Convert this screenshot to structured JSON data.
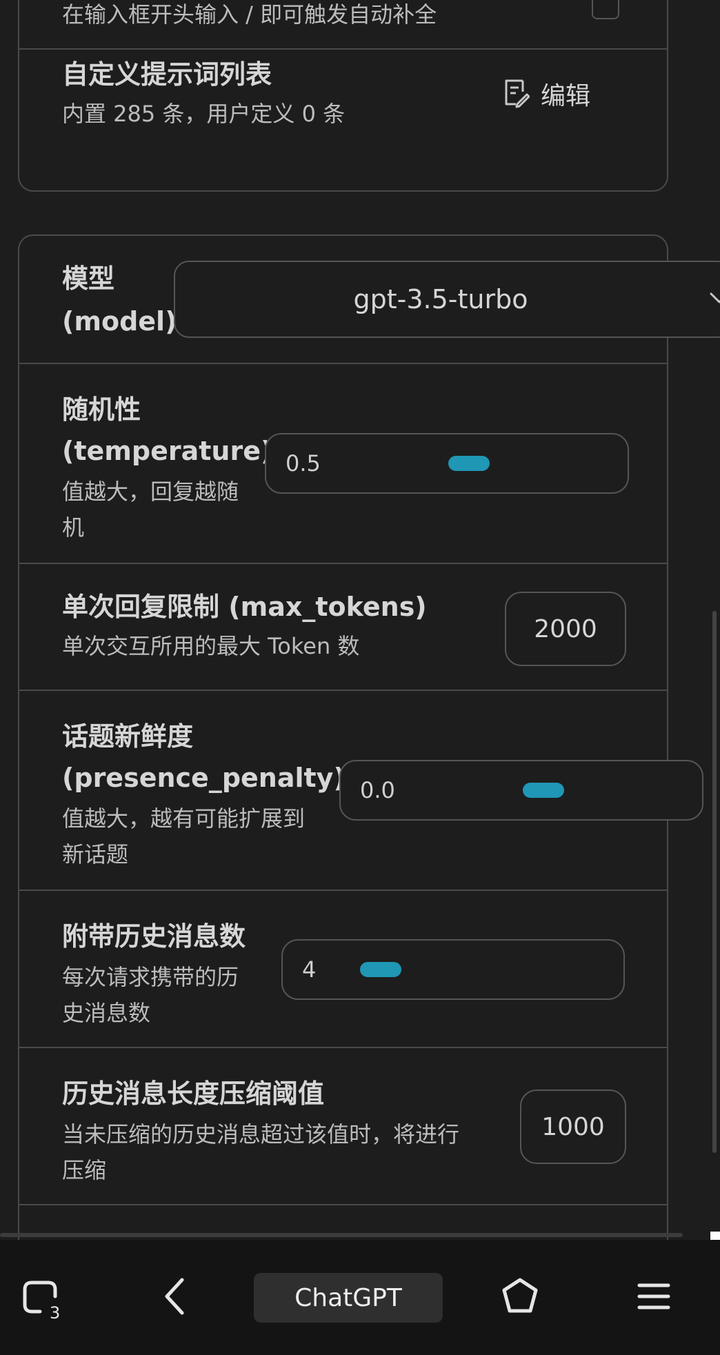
{
  "prompt_section": {
    "autocomplete_hint": "在输入框开头输入 / 即可触发自动补全",
    "custom_prompts": {
      "title": "自定义提示词列表",
      "subtitle": "内置 285 条，用户定义 0 条",
      "edit_label": "编辑"
    }
  },
  "model": {
    "label_line1": "模型",
    "label_line2": "(model)",
    "selected": "gpt-3.5-turbo"
  },
  "temperature": {
    "title_line1": "随机性",
    "title_line2": "(temperature)",
    "desc_line1": "值越大，回复越随",
    "desc_line2": "机",
    "value": "0.5"
  },
  "max_tokens": {
    "title": "单次回复限制 (max_tokens)",
    "desc": "单次交互所用的最大 Token 数",
    "value": "2000"
  },
  "presence_penalty": {
    "title_line1": "话题新鲜度",
    "title_line2": "(presence_penalty)",
    "desc_line1": "值越大，越有可能扩展到",
    "desc_line2": "新话题",
    "value": "0.0"
  },
  "history_count": {
    "title": "附带历史消息数",
    "desc_line1": "每次请求携带的历",
    "desc_line2": "史消息数",
    "value": "4"
  },
  "compress_threshold": {
    "title": "历史消息长度压缩阈值",
    "desc_line1": "当未压缩的历史消息超过该值时，将进行",
    "desc_line2": "压缩",
    "value": "1000"
  },
  "browser_bar": {
    "tabs_count": "3",
    "center_label": "ChatGPT"
  },
  "colors": {
    "background": "#1d1d1d",
    "border": "#4a4a4a",
    "slider_thumb": "#1f97b5",
    "bottom_bar": "#141414"
  }
}
